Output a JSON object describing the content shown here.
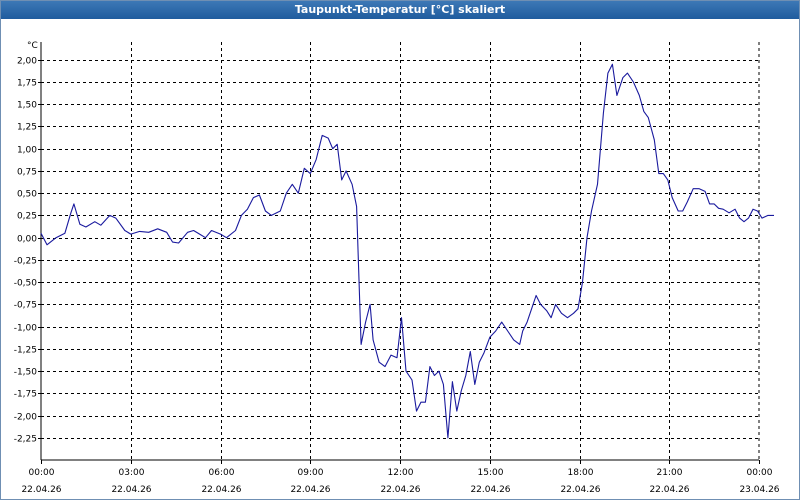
{
  "window": {
    "title": "Taupunkt-Temperatur [°C] skaliert"
  },
  "colors": {
    "series": "#1a1a9e",
    "grid": "#000000",
    "titlebar": "#2a66a8"
  },
  "chart_data": {
    "type": "line",
    "title": "Taupunkt-Temperatur [°C] skaliert",
    "ylabel": "°C",
    "xlabel": "",
    "ylim": [
      -2.5,
      2.2
    ],
    "xlim": [
      0,
      24
    ],
    "grid": true,
    "legend": "none",
    "y_ticks": [
      "2,00",
      "1,75",
      "1,50",
      "1,25",
      "1,00",
      "0,75",
      "0,50",
      "0,25",
      "0,00",
      "-0,25",
      "-0,50",
      "-0,75",
      "-1,00",
      "-1,25",
      "-1,50",
      "-1,75",
      "-2,00",
      "-2,25"
    ],
    "y_tick_values": [
      2.0,
      1.75,
      1.5,
      1.25,
      1.0,
      0.75,
      0.5,
      0.25,
      0.0,
      -0.25,
      -0.5,
      -0.75,
      -1.0,
      -1.25,
      -1.5,
      -1.75,
      -2.0,
      -2.25
    ],
    "x_ticks": [
      {
        "time": "00:00",
        "date": "22.04.26",
        "hour": 0
      },
      {
        "time": "03:00",
        "date": "22.04.26",
        "hour": 3
      },
      {
        "time": "06:00",
        "date": "22.04.26",
        "hour": 6
      },
      {
        "time": "09:00",
        "date": "22.04.26",
        "hour": 9
      },
      {
        "time": "12:00",
        "date": "22.04.26",
        "hour": 12
      },
      {
        "time": "15:00",
        "date": "22.04.26",
        "hour": 15
      },
      {
        "time": "18:00",
        "date": "22.04.26",
        "hour": 18
      },
      {
        "time": "21:00",
        "date": "22.04.26",
        "hour": 21
      },
      {
        "time": "00:00",
        "date": "23.04.26",
        "hour": 24
      }
    ],
    "series": [
      {
        "color": "#1a1a9e",
        "points": [
          [
            0.0,
            0.05
          ],
          [
            0.2,
            -0.08
          ],
          [
            0.5,
            0.0
          ],
          [
            0.8,
            0.05
          ],
          [
            1.0,
            0.28
          ],
          [
            1.1,
            0.38
          ],
          [
            1.3,
            0.15
          ],
          [
            1.5,
            0.12
          ],
          [
            1.8,
            0.18
          ],
          [
            2.0,
            0.14
          ],
          [
            2.3,
            0.25
          ],
          [
            2.5,
            0.22
          ],
          [
            2.8,
            0.08
          ],
          [
            3.0,
            0.04
          ],
          [
            3.3,
            0.07
          ],
          [
            3.6,
            0.06
          ],
          [
            3.9,
            0.1
          ],
          [
            4.2,
            0.06
          ],
          [
            4.4,
            -0.05
          ],
          [
            4.6,
            -0.06
          ],
          [
            4.9,
            0.06
          ],
          [
            5.1,
            0.08
          ],
          [
            5.3,
            0.04
          ],
          [
            5.5,
            0.0
          ],
          [
            5.7,
            0.08
          ],
          [
            6.0,
            0.04
          ],
          [
            6.2,
            0.0
          ],
          [
            6.5,
            0.08
          ],
          [
            6.7,
            0.25
          ],
          [
            6.9,
            0.32
          ],
          [
            7.1,
            0.45
          ],
          [
            7.3,
            0.48
          ],
          [
            7.5,
            0.3
          ],
          [
            7.7,
            0.25
          ],
          [
            8.0,
            0.3
          ],
          [
            8.2,
            0.5
          ],
          [
            8.4,
            0.6
          ],
          [
            8.6,
            0.5
          ],
          [
            8.8,
            0.78
          ],
          [
            9.0,
            0.72
          ],
          [
            9.2,
            0.88
          ],
          [
            9.4,
            1.15
          ],
          [
            9.6,
            1.12
          ],
          [
            9.75,
            1.0
          ],
          [
            9.9,
            1.05
          ],
          [
            10.05,
            0.65
          ],
          [
            10.2,
            0.75
          ],
          [
            10.4,
            0.6
          ],
          [
            10.55,
            0.35
          ],
          [
            10.7,
            -1.2
          ],
          [
            10.85,
            -0.95
          ],
          [
            11.0,
            -0.75
          ],
          [
            11.1,
            -1.15
          ],
          [
            11.3,
            -1.4
          ],
          [
            11.5,
            -1.45
          ],
          [
            11.7,
            -1.32
          ],
          [
            11.9,
            -1.35
          ],
          [
            12.05,
            -0.9
          ],
          [
            12.2,
            -1.5
          ],
          [
            12.4,
            -1.6
          ],
          [
            12.55,
            -1.95
          ],
          [
            12.7,
            -1.85
          ],
          [
            12.85,
            -1.85
          ],
          [
            13.0,
            -1.45
          ],
          [
            13.15,
            -1.55
          ],
          [
            13.3,
            -1.5
          ],
          [
            13.45,
            -1.65
          ],
          [
            13.6,
            -2.25
          ],
          [
            13.75,
            -1.62
          ],
          [
            13.9,
            -1.95
          ],
          [
            14.05,
            -1.72
          ],
          [
            14.2,
            -1.55
          ],
          [
            14.35,
            -1.28
          ],
          [
            14.5,
            -1.65
          ],
          [
            14.65,
            -1.4
          ],
          [
            14.8,
            -1.3
          ],
          [
            15.0,
            -1.12
          ],
          [
            15.2,
            -1.05
          ],
          [
            15.4,
            -0.95
          ],
          [
            15.6,
            -1.05
          ],
          [
            15.8,
            -1.15
          ],
          [
            16.0,
            -1.2
          ],
          [
            16.1,
            -1.05
          ],
          [
            16.25,
            -0.95
          ],
          [
            16.4,
            -0.8
          ],
          [
            16.55,
            -0.65
          ],
          [
            16.7,
            -0.75
          ],
          [
            16.9,
            -0.82
          ],
          [
            17.05,
            -0.9
          ],
          [
            17.2,
            -0.75
          ],
          [
            17.4,
            -0.85
          ],
          [
            17.6,
            -0.9
          ],
          [
            17.8,
            -0.85
          ],
          [
            17.95,
            -0.8
          ],
          [
            18.1,
            -0.5
          ],
          [
            18.25,
            0.0
          ],
          [
            18.4,
            0.3
          ],
          [
            18.6,
            0.6
          ],
          [
            18.8,
            1.4
          ],
          [
            18.95,
            1.85
          ],
          [
            19.1,
            1.95
          ],
          [
            19.25,
            1.6
          ],
          [
            19.45,
            1.8
          ],
          [
            19.6,
            1.85
          ],
          [
            19.8,
            1.75
          ],
          [
            20.0,
            1.6
          ],
          [
            20.15,
            1.42
          ],
          [
            20.3,
            1.35
          ],
          [
            20.5,
            1.1
          ],
          [
            20.65,
            0.72
          ],
          [
            20.8,
            0.72
          ],
          [
            20.95,
            0.65
          ],
          [
            21.1,
            0.45
          ],
          [
            21.3,
            0.3
          ],
          [
            21.45,
            0.3
          ],
          [
            21.6,
            0.4
          ],
          [
            21.8,
            0.55
          ],
          [
            22.0,
            0.55
          ],
          [
            22.2,
            0.52
          ],
          [
            22.35,
            0.38
          ],
          [
            22.5,
            0.38
          ],
          [
            22.65,
            0.33
          ],
          [
            22.8,
            0.32
          ],
          [
            23.0,
            0.28
          ],
          [
            23.2,
            0.32
          ],
          [
            23.35,
            0.22
          ],
          [
            23.5,
            0.18
          ],
          [
            23.65,
            0.22
          ],
          [
            23.8,
            0.32
          ],
          [
            23.95,
            0.3
          ],
          [
            24.1,
            0.22
          ],
          [
            24.3,
            0.25
          ],
          [
            24.5,
            0.25
          ]
        ]
      }
    ]
  }
}
